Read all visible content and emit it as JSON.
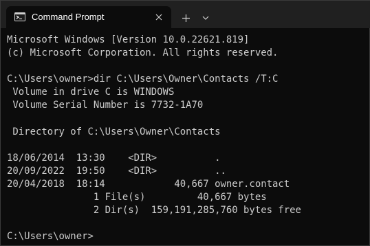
{
  "window": {
    "tab_title": "Command Prompt",
    "tab_icon": "terminal-icon",
    "close_icon": "close-icon",
    "new_tab_icon": "plus-icon",
    "dropdown_icon": "chevron-down-icon"
  },
  "console": {
    "lines": [
      "Microsoft Windows [Version 10.0.22621.819]",
      "(c) Microsoft Corporation. All rights reserved.",
      "",
      "C:\\Users\\owner>dir C:\\Users\\Owner\\Contacts /T:C",
      " Volume in drive C is WINDOWS",
      " Volume Serial Number is 7732-1A70",
      "",
      " Directory of C:\\Users\\Owner\\Contacts",
      "",
      "18/06/2014  13:30    <DIR>          .",
      "20/09/2022  19:50    <DIR>          ..",
      "20/04/2018  18:14            40,667 owner.contact",
      "               1 File(s)         40,667 bytes",
      "               2 Dir(s)  159,191,285,760 bytes free",
      "",
      "C:\\Users\\owner>"
    ]
  },
  "colors": {
    "titlebar": "#202020",
    "tab_background": "#0c0c0c",
    "console_background": "#0c0c0c",
    "console_text": "#cccccc"
  }
}
